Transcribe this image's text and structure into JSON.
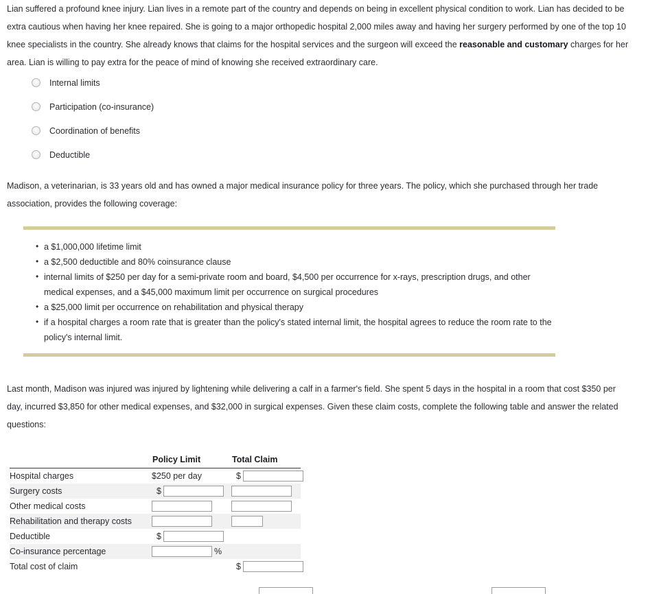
{
  "question1": {
    "paragraph_before_bold": "Lian suffered a profound knee injury. Lian lives in a remote part of the country and depends on being in excellent physical condition to work. Lian has decided to be extra cautious when having her knee repaired. She is going to a major orthopedic hospital 2,000 miles away and having her surgery performed by one of the top 10 knee specialists in the country. She already knows that claims for the hospital services and the surgeon will exceed the ",
    "bold_phrase": "reasonable and customary",
    "paragraph_after_bold": " charges for her area. Lian is willing to pay extra for the peace of mind of knowing she received extraordinary care.",
    "options": [
      {
        "label": "Internal limits"
      },
      {
        "label": "Participation (co-insurance)"
      },
      {
        "label": "Coordination of benefits"
      },
      {
        "label": "Deductible"
      }
    ]
  },
  "question2": {
    "policy_intro": "Madison, a veterinarian, is 33 years old and has owned a major medical insurance policy for three years. The policy, which she purchased through her trade association, provides the following coverage:",
    "coverage_items": [
      "a $1,000,000 lifetime limit",
      "a $2,500 deductible and 80% coinsurance clause",
      "internal limits of $250 per day for a semi-private room and board, $4,500 per occurrence for x-rays, prescription drugs, and other medical expenses, and a $45,000 maximum limit per occurrence on surgical procedures",
      "a $25,000 limit per occurrence on rehabilitation and physical therapy",
      "if a hospital charges a room rate that is greater than the policy's stated internal limit, the hospital agrees to reduce the room rate to the policy's internal limit."
    ],
    "claim_intro": "Last month, Madison was injured was injured by lightening while delivering a calf in a farmer's field. She spent 5 days in the hospital in a room that cost $350 per day, incurred $3,850 for other medical expenses, and $32,000 in surgical expenses. Given these claim costs, complete the following table and answer the related questions:"
  },
  "claim_table": {
    "headers": {
      "label": "",
      "policy_limit": "Policy Limit",
      "total_claim": "Total Claim"
    },
    "rows": [
      {
        "label": "Hospital charges",
        "policy_limit_text": "$250 per day",
        "policy_input": false,
        "policy_prefix": "",
        "policy_suffix": "",
        "policy_value": "",
        "claim_input": true,
        "claim_prefix": "$",
        "claim_value": "",
        "claim_width": "wide",
        "shaded": false
      },
      {
        "label": "Surgery costs",
        "policy_limit_text": "",
        "policy_input": true,
        "policy_prefix": "$",
        "policy_suffix": "",
        "policy_value": "",
        "claim_input": true,
        "claim_prefix": "",
        "claim_value": "",
        "claim_width": "wide",
        "shaded": true
      },
      {
        "label": "Other medical costs",
        "policy_limit_text": "",
        "policy_input": true,
        "policy_prefix": "",
        "policy_suffix": "",
        "policy_value": "",
        "claim_input": true,
        "claim_prefix": "",
        "claim_value": "",
        "claim_width": "wide",
        "shaded": false
      },
      {
        "label": "Rehabilitation and therapy costs",
        "policy_limit_text": "",
        "policy_input": true,
        "policy_prefix": "",
        "policy_suffix": "",
        "policy_value": "",
        "claim_input": true,
        "claim_prefix": "",
        "claim_value": "",
        "claim_width": "narrow",
        "shaded": true
      },
      {
        "label": "Deductible",
        "policy_limit_text": "",
        "policy_input": true,
        "policy_prefix": "$",
        "policy_suffix": "",
        "policy_value": "",
        "claim_input": false,
        "claim_prefix": "",
        "claim_value": "",
        "claim_width": "wide",
        "shaded": false
      },
      {
        "label": "Co-insurance percentage",
        "policy_limit_text": "",
        "policy_input": true,
        "policy_prefix": "",
        "policy_suffix": "%",
        "policy_value": "",
        "claim_input": false,
        "claim_prefix": "",
        "claim_value": "",
        "claim_width": "wide",
        "shaded": true
      },
      {
        "label": "Total cost of claim",
        "policy_limit_text": "",
        "policy_input": false,
        "policy_prefix": "",
        "policy_suffix": "",
        "policy_value": "",
        "claim_input": true,
        "claim_prefix": "$",
        "claim_value": "",
        "claim_width": "wide",
        "shaded": false
      }
    ]
  },
  "bottom_partial_fields": [
    {
      "value": ""
    },
    {
      "value": ""
    }
  ],
  "colors": {
    "rule": "#d5cc9c",
    "row_shade": "#f1f1f1",
    "text": "#2b2b33",
    "input_border": "#9b9b9b"
  }
}
